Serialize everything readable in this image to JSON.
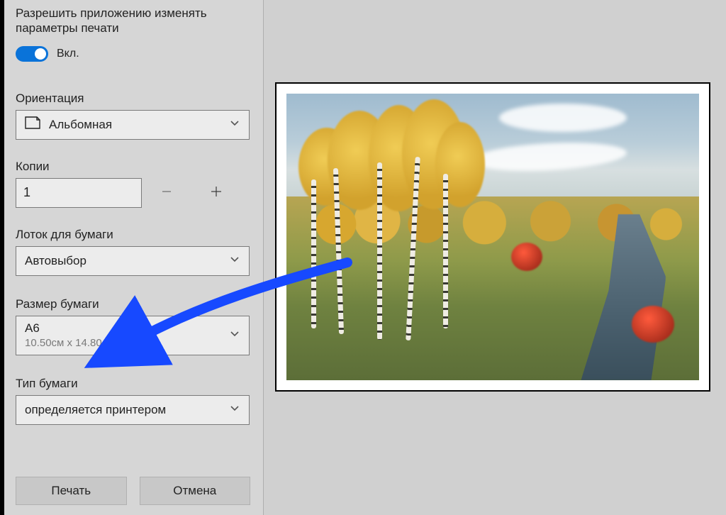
{
  "allow": {
    "title": "Разрешить приложению изменять параметры печати",
    "state_label": "Вкл.",
    "on": true
  },
  "orientation": {
    "label": "Ориентация",
    "value": "Альбомная"
  },
  "copies": {
    "label": "Копии",
    "value": "1"
  },
  "tray": {
    "label": "Лоток для бумаги",
    "value": "Автовыбор"
  },
  "paper_size": {
    "label": "Размер бумаги",
    "value": "A6",
    "dimensions": "10.50см x 14.80см"
  },
  "paper_type": {
    "label": "Тип бумаги",
    "value": "определяется принтером"
  },
  "footer": {
    "print": "Печать",
    "cancel": "Отмена"
  },
  "colors": {
    "accent": "#0a73d9",
    "annotation": "#1749ff"
  }
}
